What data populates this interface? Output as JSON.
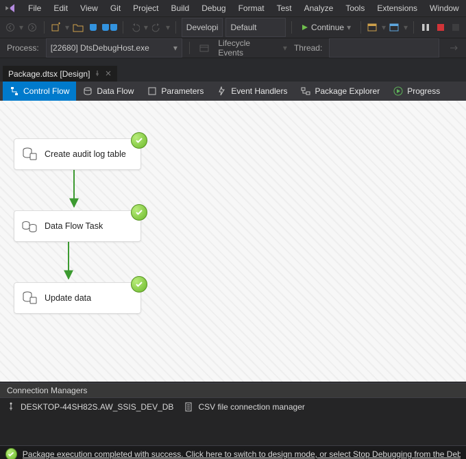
{
  "menu": {
    "items": [
      "File",
      "Edit",
      "View",
      "Git",
      "Project",
      "Build",
      "Debug",
      "Format",
      "Test",
      "Analyze",
      "Tools",
      "Extensions",
      "Window"
    ]
  },
  "toolbar1": {
    "config": "Developi",
    "platform": "Default",
    "continue_label": "Continue"
  },
  "processbar": {
    "label": "Process:",
    "process": "[22680] DtsDebugHost.exe",
    "lifecycle_label": "Lifecycle Events",
    "thread_label": "Thread:"
  },
  "doctab": {
    "title": "Package.dtsx [Design]"
  },
  "subtabs": {
    "items": [
      {
        "label": "Control Flow",
        "icon": "flow-icon"
      },
      {
        "label": "Data Flow",
        "icon": "dataflow-icon"
      },
      {
        "label": "Parameters",
        "icon": "parameters-icon"
      },
      {
        "label": "Event Handlers",
        "icon": "event-icon"
      },
      {
        "label": "Package Explorer",
        "icon": "explorer-icon"
      },
      {
        "label": "Progress",
        "icon": "play-icon"
      }
    ]
  },
  "tasks": {
    "t1": {
      "label": "Create audit log table"
    },
    "t2": {
      "label": "Data Flow Task"
    },
    "t3": {
      "label": "Update data"
    }
  },
  "cm_panel": {
    "title": "Connection Managers",
    "items": [
      {
        "label": "DESKTOP-44SH82S.AW_SSIS_DEV_DB"
      },
      {
        "label": "CSV file connection manager"
      }
    ]
  },
  "statusbar": {
    "message": "Package execution completed with success. Click here to switch to design mode, or select Stop Debugging from the Debug menu."
  }
}
